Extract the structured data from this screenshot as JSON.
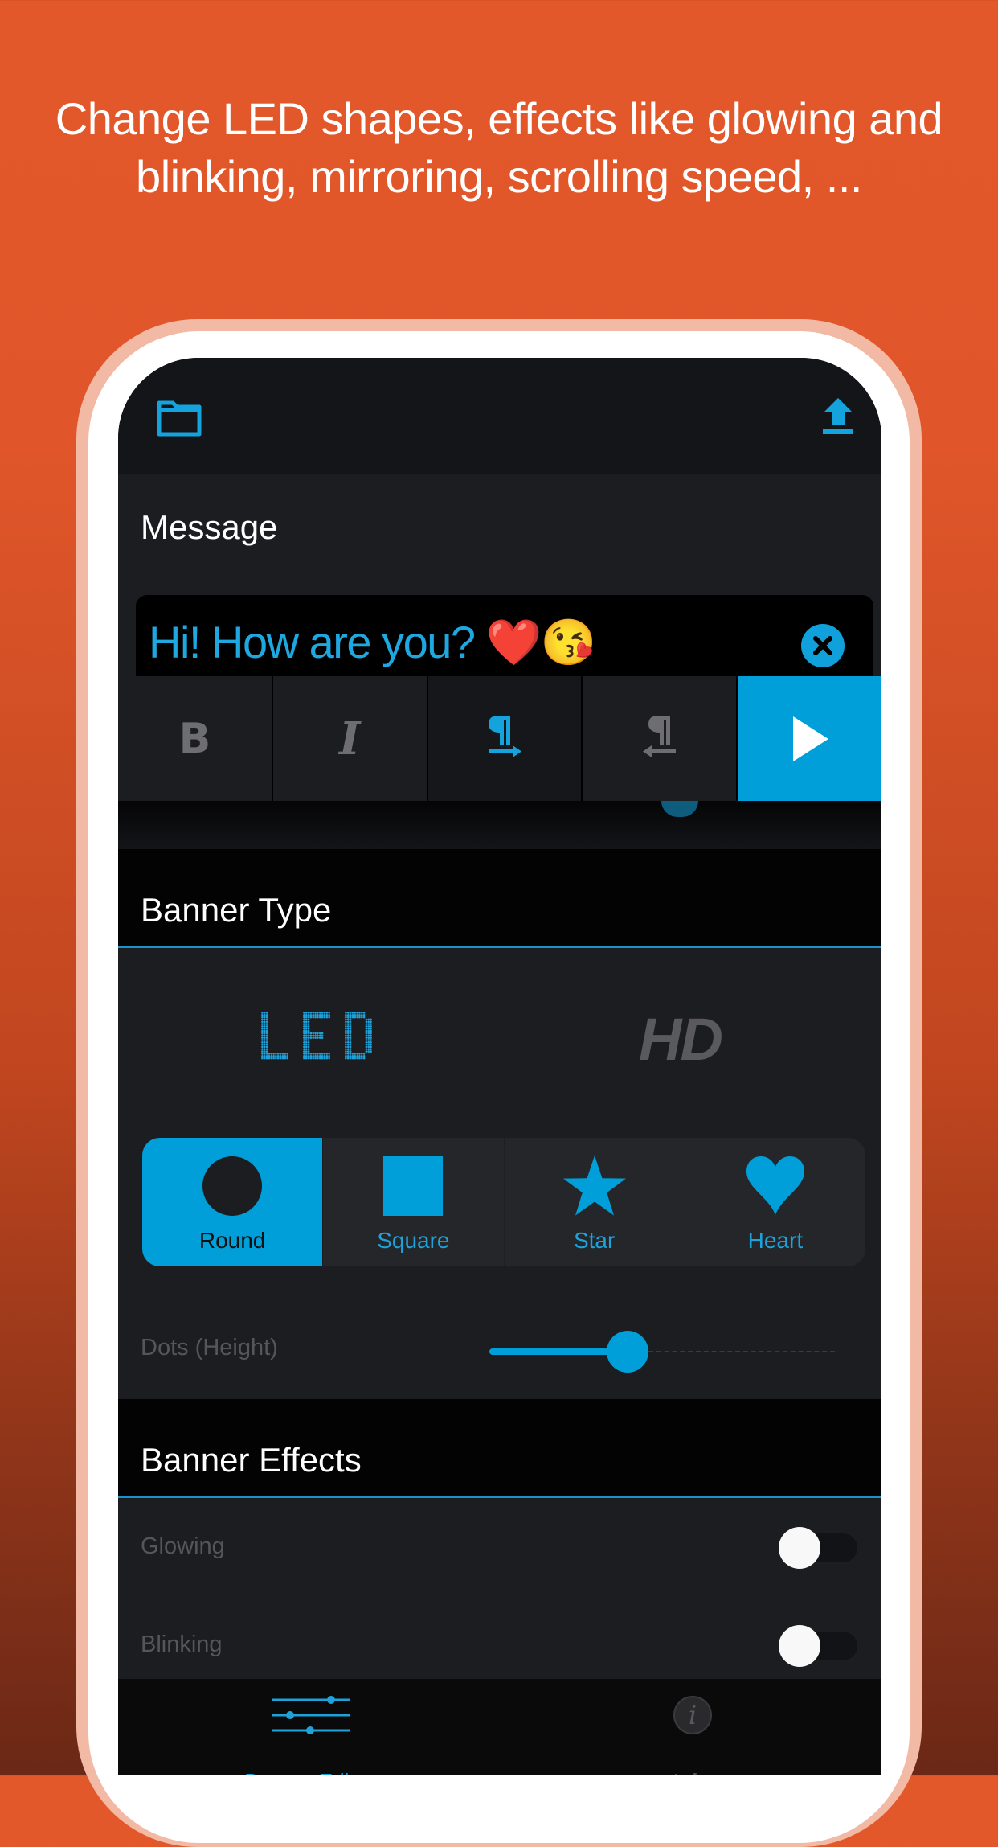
{
  "caption": {
    "line1": "Change LED shapes, effects like glowing and",
    "line2": "blinking, mirroring, scrolling speed, ..."
  },
  "colors": {
    "accent": "#009FDA",
    "background_top": "#E3582A",
    "background_bottom": "#6B2816",
    "screen_bg": "#1C1D21",
    "header_bg": "#030303"
  },
  "topbar": {
    "left_icon": "folder-icon",
    "right_icon": "upload-icon"
  },
  "message": {
    "label": "Message",
    "value": "Hi! How are you? ❤️😘",
    "clear_icon": "close-circle-icon"
  },
  "toolbar": {
    "bold_label": "B",
    "italic_label": "I",
    "ltr_icon": "paragraph-ltr-icon",
    "rtl_icon": "paragraph-rtl-icon",
    "play_icon": "play-icon",
    "ltr_active": true
  },
  "banner_type": {
    "title": "Banner Type",
    "options": [
      {
        "label": "LED",
        "selected": true
      },
      {
        "label": "HD",
        "selected": false
      }
    ]
  },
  "shapes": {
    "selected": "Round",
    "options": [
      {
        "label": "Round",
        "icon": "circle-icon"
      },
      {
        "label": "Square",
        "icon": "square-icon"
      },
      {
        "label": "Star",
        "icon": "star-icon"
      },
      {
        "label": "Heart",
        "icon": "heart-icon"
      }
    ]
  },
  "dots_height": {
    "label": "Dots (Height)",
    "value_fraction": 0.4
  },
  "banner_effects": {
    "title": "Banner Effects",
    "items": [
      {
        "label": "Glowing",
        "enabled": false
      },
      {
        "label": "Blinking",
        "enabled": false
      }
    ]
  },
  "bottom_nav": {
    "items": [
      {
        "label": "Banner-Editor",
        "icon": "sliders-icon",
        "active": true
      },
      {
        "label": "Info",
        "icon": "info-icon",
        "active": false
      }
    ]
  }
}
